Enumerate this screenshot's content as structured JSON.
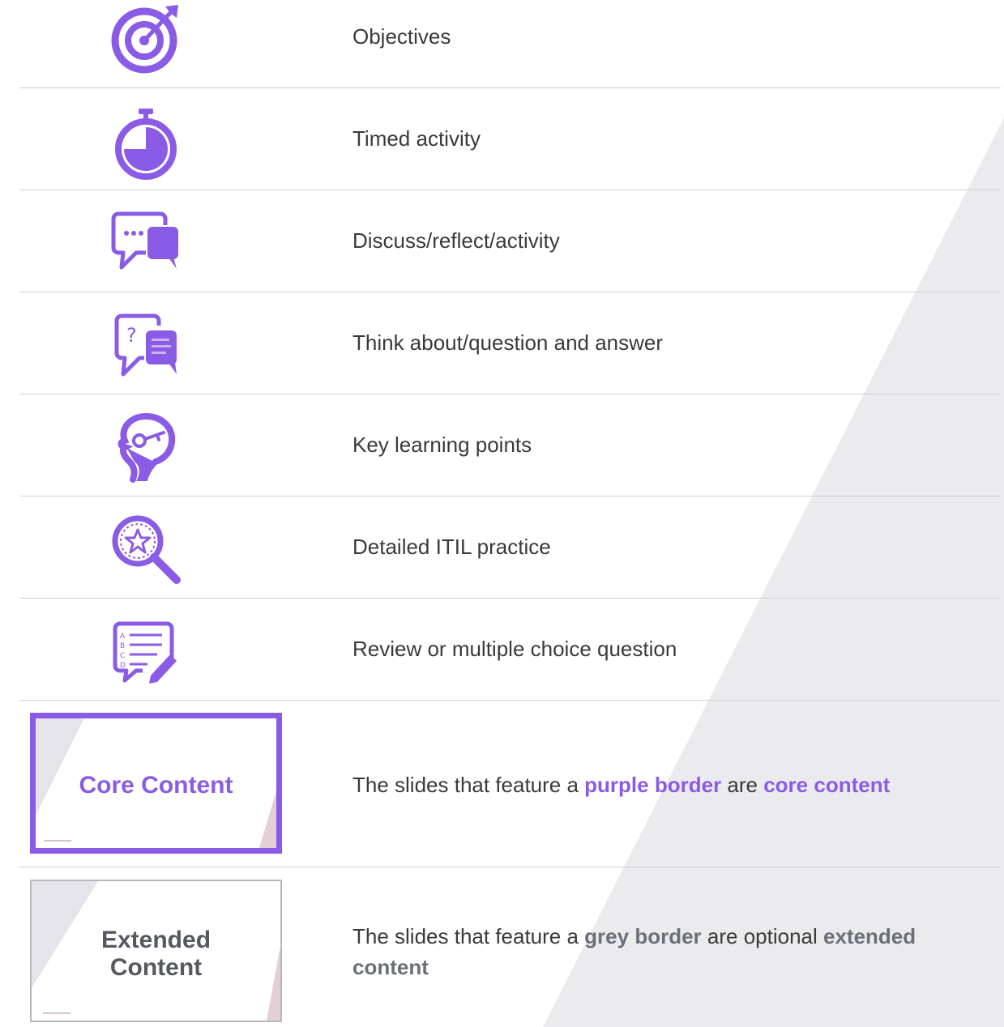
{
  "legend": {
    "items": [
      {
        "icon": "target-icon",
        "label": "Objectives"
      },
      {
        "icon": "stopwatch-icon",
        "label": "Timed activity"
      },
      {
        "icon": "chat-bubbles-icon",
        "label": "Discuss/reflect/activity"
      },
      {
        "icon": "question-bubbles-icon",
        "label": "Think about/question and answer"
      },
      {
        "icon": "head-key-icon",
        "label": "Key learning points"
      },
      {
        "icon": "magnifier-star-icon",
        "label": "Detailed ITIL practice"
      },
      {
        "icon": "checklist-bubble-icon",
        "label": "Review or multiple choice question"
      }
    ],
    "core": {
      "thumb_title": "Core Content",
      "text_1": "The slides that feature a ",
      "highlight_1": "purple border",
      "text_2": " are ",
      "highlight_2": "core content"
    },
    "extended": {
      "thumb_title_1": "Extended",
      "thumb_title_2": "Content",
      "text_1": "The slides that feature a ",
      "highlight_1": "grey border",
      "text_2": " are optional ",
      "highlight_2": "extended content"
    }
  },
  "colors": {
    "accent": "#8a5ce6",
    "grey_border": "#b8b8bc",
    "stripe": "#ebebee"
  }
}
